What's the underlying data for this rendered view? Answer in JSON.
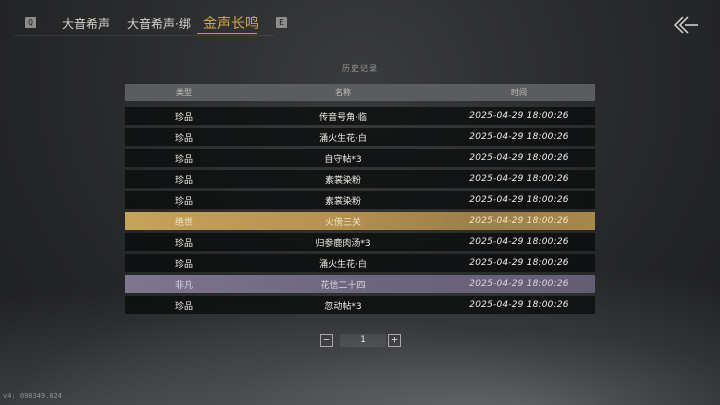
{
  "topbar": {
    "left_key": "Q",
    "right_key": "E",
    "tabs": [
      {
        "label": "大音希声"
      },
      {
        "label": "大音希声·绑"
      },
      {
        "label": "金声长鸣"
      }
    ],
    "active_tab": "金声长鸣",
    "back_icon": "back-arrow-icon"
  },
  "history": {
    "title": "历史记录",
    "columns": {
      "type": "类型",
      "name": "名称",
      "time": "时间"
    },
    "rows": [
      {
        "type": "珍品",
        "name": "传音号角·临",
        "time": "2025-04-29 18:00:26"
      },
      {
        "type": "珍品",
        "name": "涌火生花·白",
        "time": "2025-04-29 18:00:26"
      },
      {
        "type": "珍品",
        "name": "自守帖*3",
        "time": "2025-04-29 18:00:26"
      },
      {
        "type": "珍品",
        "name": "素裳染粉",
        "time": "2025-04-29 18:00:26"
      },
      {
        "type": "珍品",
        "name": "素裳染粉",
        "time": "2025-04-29 18:00:26"
      },
      {
        "type": "绝世",
        "name": "火傍三关",
        "time": "2025-04-29 18:00:26",
        "rarity_color": "#c4a35b"
      },
      {
        "type": "珍品",
        "name": "归参鹿肉汤*3",
        "time": "2025-04-29 18:00:26"
      },
      {
        "type": "珍品",
        "name": "涌火生花·白",
        "time": "2025-04-29 18:00:26"
      },
      {
        "type": "非凡",
        "name": "花信二十四",
        "time": "2025-04-29 18:00:26",
        "rarity_color": "#7e7691"
      },
      {
        "type": "珍品",
        "name": "忽动帖*3",
        "time": "2025-04-29 18:00:26"
      }
    ]
  },
  "pager": {
    "minus": "−",
    "page": "1",
    "plus": "+"
  },
  "coords": "v4: 098349.824"
}
